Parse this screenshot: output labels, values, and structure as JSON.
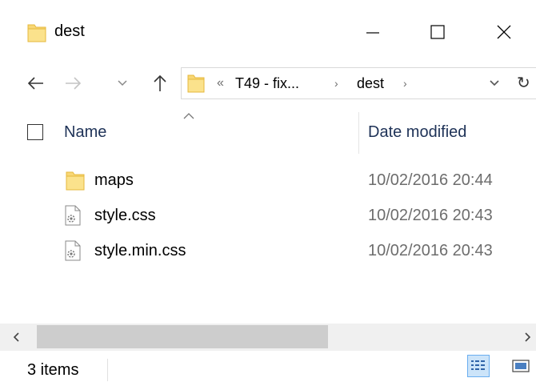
{
  "window": {
    "title": "dest",
    "controls": [
      "minimize-icon",
      "maximize-icon",
      "close-icon"
    ]
  },
  "nav": {
    "icons": [
      "back-arrow-icon",
      "forward-arrow-icon",
      "recent-dropdown-icon",
      "up-arrow-icon"
    ],
    "address": {
      "overflow": "«",
      "crumbs": [
        "T49 - fix...",
        "dest"
      ],
      "separator": "›",
      "refresh_icon": "↻"
    }
  },
  "columns": {
    "name": "Name",
    "date": "Date modified"
  },
  "files": [
    {
      "name": "maps",
      "date": "10/02/2016 20:44",
      "icon": "folder-icon"
    },
    {
      "name": "style.css",
      "date": "10/02/2016 20:43",
      "icon": "css-file-icon"
    },
    {
      "name": "style.min.css",
      "date": "10/02/2016 20:43",
      "icon": "css-file-icon"
    }
  ],
  "status": {
    "count": "3 items"
  },
  "colors": {
    "folder": "#f8d775",
    "folder_dark": "#e6b83d",
    "header_text": "#1e3257",
    "muted_text": "#6d6d6d",
    "selected_view": "#cce4f9",
    "scroll_thumb": "#cdcdcd"
  }
}
